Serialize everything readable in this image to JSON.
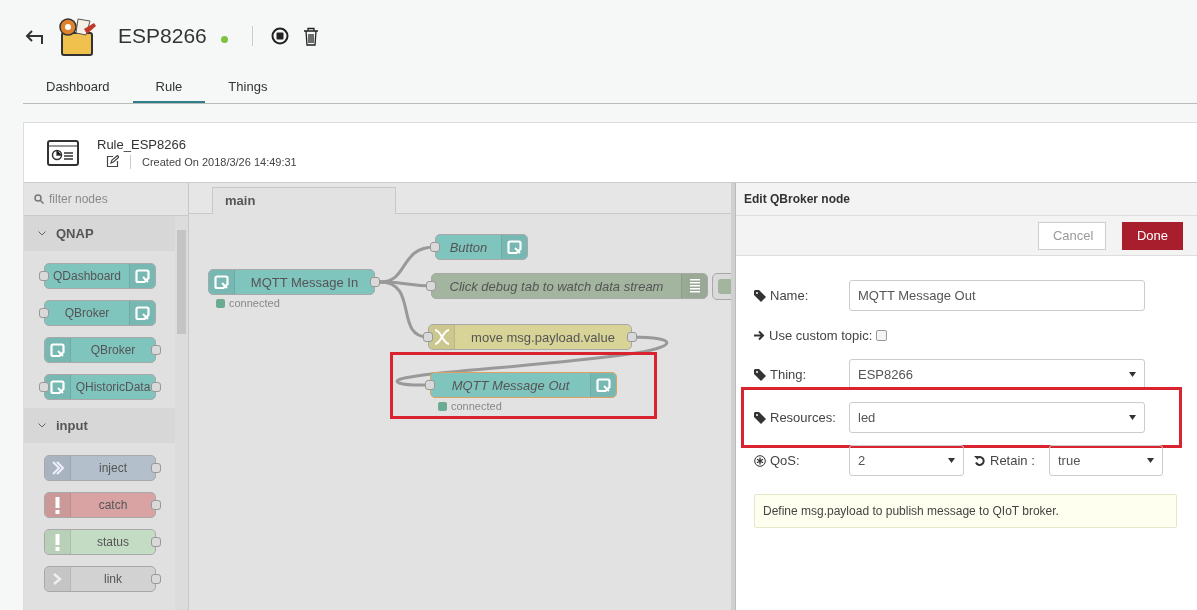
{
  "header": {
    "title": "ESP8266",
    "online": true
  },
  "tabs": [
    {
      "label": "Dashboard",
      "selected": false
    },
    {
      "label": "Rule",
      "selected": true
    },
    {
      "label": "Things",
      "selected": false
    }
  ],
  "rule": {
    "name": "Rule_ESP8266",
    "created": "Created On 2018/3/26 14:49:31"
  },
  "palette": {
    "placeholder": "filter nodes",
    "categories": [
      {
        "name": "QNAP",
        "expanded": true,
        "nodes": [
          {
            "label": "QDashboard",
            "kind": "qnap",
            "color": "#80c4be",
            "input": true,
            "output": false
          },
          {
            "label": "QBroker",
            "kind": "qnap",
            "color": "#80c4be",
            "input": true,
            "output": false
          },
          {
            "label": "QBroker",
            "kind": "qnap",
            "color": "#80c4be",
            "input": false,
            "output": true
          },
          {
            "label": "QHistoricData",
            "kind": "qnap",
            "color": "#80c4be",
            "input": true,
            "output": true
          }
        ]
      },
      {
        "name": "input",
        "expanded": true,
        "nodes": [
          {
            "label": "inject",
            "kind": "inject",
            "color": "#b3bfcb",
            "input": false,
            "output": true
          },
          {
            "label": "catch",
            "kind": "catch",
            "color": "#d9a3a3",
            "input": false,
            "output": true
          },
          {
            "label": "status",
            "kind": "status",
            "color": "#c4dcc4",
            "input": false,
            "output": true
          },
          {
            "label": "link",
            "kind": "link",
            "color": "#d2d2d2",
            "input": false,
            "output": true
          }
        ]
      }
    ]
  },
  "canvas": {
    "tabs": [
      {
        "label": "main",
        "selected": true
      }
    ],
    "nodes": [
      {
        "label": "MQTT Message In",
        "kind": "qnap",
        "color": "#80c4be",
        "input": false,
        "output": true,
        "italic": false,
        "selected": false,
        "highlighted": false,
        "status": "connected"
      },
      {
        "label": "Button",
        "kind": "qnap",
        "color": "#80c4be",
        "input": true,
        "output": false,
        "italic": true,
        "selected": false,
        "highlighted": false
      },
      {
        "label": "Click debug tab to watch data stream",
        "kind": "debug",
        "color": "#a3b49f",
        "input": true,
        "output": false,
        "italic": true,
        "selected": false,
        "highlighted": false
      },
      {
        "label": "move msg.payload.value",
        "kind": "change",
        "color": "#d8d497",
        "input": true,
        "output": true,
        "italic": false,
        "selected": false,
        "highlighted": false
      },
      {
        "label": "MQTT Message Out",
        "kind": "qnap",
        "color": "#80c4be",
        "input": true,
        "output": false,
        "italic": true,
        "selected": true,
        "highlighted": true,
        "status": "connected"
      }
    ]
  },
  "editor": {
    "title": "Edit QBroker node",
    "buttons": [
      {
        "label": "Cancel",
        "kind": "secondary"
      },
      {
        "label": "Done",
        "kind": "primary"
      }
    ],
    "fields": [
      {
        "kind": "text",
        "label": "Name:",
        "value": "MQTT Message Out",
        "highlighted": false
      },
      {
        "kind": "checkbox",
        "label": "Use custom topic:",
        "checked": false,
        "highlighted": false
      },
      {
        "kind": "select",
        "label": "Thing:",
        "value": "ESP8266",
        "highlighted": false
      },
      {
        "kind": "select",
        "label": "Resources:",
        "value": "led",
        "highlighted": true
      },
      {
        "kind": "pair",
        "highlighted": false,
        "items": [
          {
            "label": "QoS:",
            "value": "2"
          },
          {
            "label": "Retain :",
            "value": "true"
          }
        ]
      }
    ],
    "tip": "Define msg.payload to publish message to QIoT broker."
  }
}
